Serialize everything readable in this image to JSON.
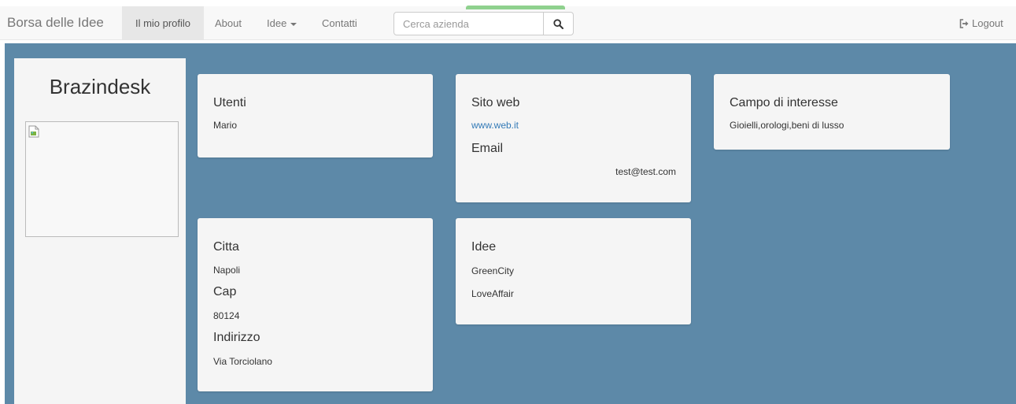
{
  "navbar": {
    "brand": "Borsa delle Idee",
    "items": [
      {
        "label": "Il mio profilo",
        "active": true
      },
      {
        "label": "About"
      },
      {
        "label": "Idee",
        "dropdown": true
      },
      {
        "label": "Contatti"
      }
    ],
    "search": {
      "value": "",
      "placeholder": "Cerca azienda",
      "button_icon": "search-icon"
    },
    "logout": {
      "label": "Logout",
      "icon": "logout-icon"
    }
  },
  "profile": {
    "name": "Brazindesk",
    "image_icon": "broken-image-icon"
  },
  "cards": {
    "utenti": {
      "title": "Utenti",
      "users": [
        "Mario"
      ]
    },
    "sito": {
      "site_title": "Sito web",
      "site_value": "www.web.it",
      "email_title": "Email",
      "email_value": "test@test.com"
    },
    "campo": {
      "title": "Campo di interesse",
      "value": "Gioielli,orologi,beni di lusso"
    },
    "citta": {
      "city_title": "Citta",
      "city_value": "Napoli",
      "cap_title": "Cap",
      "cap_value": "80124",
      "address_title": "Indirizzo",
      "address_value": "Via Torciolano"
    },
    "idee": {
      "title": "Idee",
      "items": [
        "GreenCity",
        "LoveAffair"
      ]
    }
  },
  "colors": {
    "background": "#5d89a8",
    "navbar": "#f8f8f8",
    "card": "#f5f5f5",
    "link": "#337ab7",
    "green_accent": "#8fd18e"
  }
}
